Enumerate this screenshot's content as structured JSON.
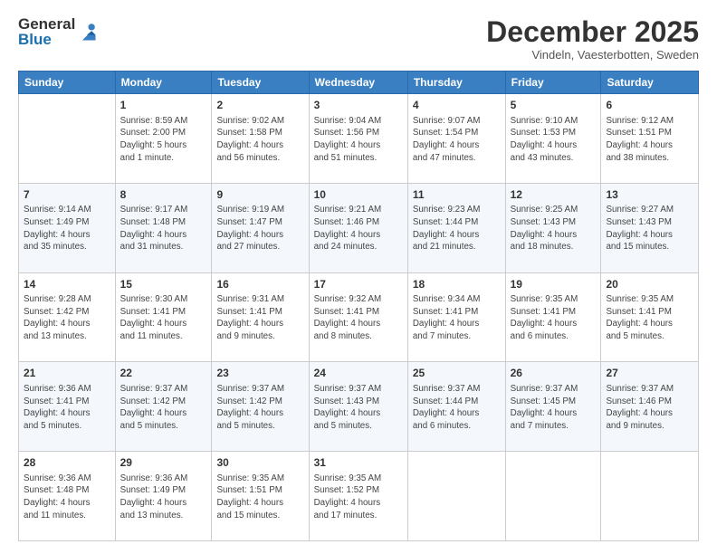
{
  "logo": {
    "general": "General",
    "blue": "Blue"
  },
  "title": "December 2025",
  "subtitle": "Vindeln, Vaesterbotten, Sweden",
  "days_of_week": [
    "Sunday",
    "Monday",
    "Tuesday",
    "Wednesday",
    "Thursday",
    "Friday",
    "Saturday"
  ],
  "weeks": [
    [
      {
        "day": "",
        "info": ""
      },
      {
        "day": "1",
        "info": "Sunrise: 8:59 AM\nSunset: 2:00 PM\nDaylight: 5 hours\nand 1 minute."
      },
      {
        "day": "2",
        "info": "Sunrise: 9:02 AM\nSunset: 1:58 PM\nDaylight: 4 hours\nand 56 minutes."
      },
      {
        "day": "3",
        "info": "Sunrise: 9:04 AM\nSunset: 1:56 PM\nDaylight: 4 hours\nand 51 minutes."
      },
      {
        "day": "4",
        "info": "Sunrise: 9:07 AM\nSunset: 1:54 PM\nDaylight: 4 hours\nand 47 minutes."
      },
      {
        "day": "5",
        "info": "Sunrise: 9:10 AM\nSunset: 1:53 PM\nDaylight: 4 hours\nand 43 minutes."
      },
      {
        "day": "6",
        "info": "Sunrise: 9:12 AM\nSunset: 1:51 PM\nDaylight: 4 hours\nand 38 minutes."
      }
    ],
    [
      {
        "day": "7",
        "info": "Sunrise: 9:14 AM\nSunset: 1:49 PM\nDaylight: 4 hours\nand 35 minutes."
      },
      {
        "day": "8",
        "info": "Sunrise: 9:17 AM\nSunset: 1:48 PM\nDaylight: 4 hours\nand 31 minutes."
      },
      {
        "day": "9",
        "info": "Sunrise: 9:19 AM\nSunset: 1:47 PM\nDaylight: 4 hours\nand 27 minutes."
      },
      {
        "day": "10",
        "info": "Sunrise: 9:21 AM\nSunset: 1:46 PM\nDaylight: 4 hours\nand 24 minutes."
      },
      {
        "day": "11",
        "info": "Sunrise: 9:23 AM\nSunset: 1:44 PM\nDaylight: 4 hours\nand 21 minutes."
      },
      {
        "day": "12",
        "info": "Sunrise: 9:25 AM\nSunset: 1:43 PM\nDaylight: 4 hours\nand 18 minutes."
      },
      {
        "day": "13",
        "info": "Sunrise: 9:27 AM\nSunset: 1:43 PM\nDaylight: 4 hours\nand 15 minutes."
      }
    ],
    [
      {
        "day": "14",
        "info": "Sunrise: 9:28 AM\nSunset: 1:42 PM\nDaylight: 4 hours\nand 13 minutes."
      },
      {
        "day": "15",
        "info": "Sunrise: 9:30 AM\nSunset: 1:41 PM\nDaylight: 4 hours\nand 11 minutes."
      },
      {
        "day": "16",
        "info": "Sunrise: 9:31 AM\nSunset: 1:41 PM\nDaylight: 4 hours\nand 9 minutes."
      },
      {
        "day": "17",
        "info": "Sunrise: 9:32 AM\nSunset: 1:41 PM\nDaylight: 4 hours\nand 8 minutes."
      },
      {
        "day": "18",
        "info": "Sunrise: 9:34 AM\nSunset: 1:41 PM\nDaylight: 4 hours\nand 7 minutes."
      },
      {
        "day": "19",
        "info": "Sunrise: 9:35 AM\nSunset: 1:41 PM\nDaylight: 4 hours\nand 6 minutes."
      },
      {
        "day": "20",
        "info": "Sunrise: 9:35 AM\nSunset: 1:41 PM\nDaylight: 4 hours\nand 5 minutes."
      }
    ],
    [
      {
        "day": "21",
        "info": "Sunrise: 9:36 AM\nSunset: 1:41 PM\nDaylight: 4 hours\nand 5 minutes."
      },
      {
        "day": "22",
        "info": "Sunrise: 9:37 AM\nSunset: 1:42 PM\nDaylight: 4 hours\nand 5 minutes."
      },
      {
        "day": "23",
        "info": "Sunrise: 9:37 AM\nSunset: 1:42 PM\nDaylight: 4 hours\nand 5 minutes."
      },
      {
        "day": "24",
        "info": "Sunrise: 9:37 AM\nSunset: 1:43 PM\nDaylight: 4 hours\nand 5 minutes."
      },
      {
        "day": "25",
        "info": "Sunrise: 9:37 AM\nSunset: 1:44 PM\nDaylight: 4 hours\nand 6 minutes."
      },
      {
        "day": "26",
        "info": "Sunrise: 9:37 AM\nSunset: 1:45 PM\nDaylight: 4 hours\nand 7 minutes."
      },
      {
        "day": "27",
        "info": "Sunrise: 9:37 AM\nSunset: 1:46 PM\nDaylight: 4 hours\nand 9 minutes."
      }
    ],
    [
      {
        "day": "28",
        "info": "Sunrise: 9:36 AM\nSunset: 1:48 PM\nDaylight: 4 hours\nand 11 minutes."
      },
      {
        "day": "29",
        "info": "Sunrise: 9:36 AM\nSunset: 1:49 PM\nDaylight: 4 hours\nand 13 minutes."
      },
      {
        "day": "30",
        "info": "Sunrise: 9:35 AM\nSunset: 1:51 PM\nDaylight: 4 hours\nand 15 minutes."
      },
      {
        "day": "31",
        "info": "Sunrise: 9:35 AM\nSunset: 1:52 PM\nDaylight: 4 hours\nand 17 minutes."
      },
      {
        "day": "",
        "info": ""
      },
      {
        "day": "",
        "info": ""
      },
      {
        "day": "",
        "info": ""
      }
    ]
  ]
}
